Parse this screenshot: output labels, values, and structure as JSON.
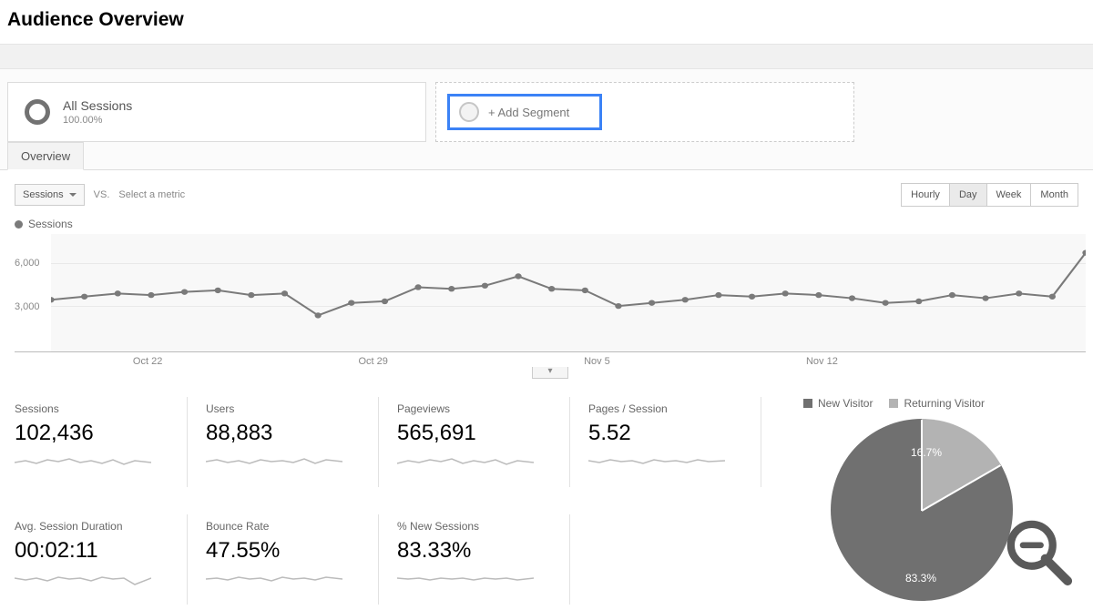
{
  "page": {
    "title": "Audience Overview"
  },
  "segments": {
    "primary": {
      "title": "All Sessions",
      "subtitle": "100.00%"
    },
    "add_label": "+ Add Segment"
  },
  "tabs": {
    "overview": "Overview"
  },
  "controls": {
    "metric": "Sessions",
    "vs": "VS.",
    "select_metric": "Select a metric",
    "periods": {
      "hourly": "Hourly",
      "day": "Day",
      "week": "Week",
      "month": "Month"
    }
  },
  "chart_legend": {
    "series": "Sessions"
  },
  "chart_data": {
    "type": "line",
    "title": "Sessions",
    "xlabel": "",
    "ylabel": "",
    "ylim": [
      0,
      7500
    ],
    "y_ticks": [
      "6,000",
      "3,000"
    ],
    "x_ticks": [
      "Oct 22",
      "Oct 29",
      "Nov 5",
      "Nov 12"
    ],
    "x_dates": [
      "Oct 18",
      "Oct 19",
      "Oct 20",
      "Oct 21",
      "Oct 22",
      "Oct 23",
      "Oct 24",
      "Oct 25",
      "Oct 26",
      "Oct 27",
      "Oct 28",
      "Oct 29",
      "Oct 30",
      "Oct 31",
      "Nov 1",
      "Nov 2",
      "Nov 3",
      "Nov 4",
      "Nov 5",
      "Nov 6",
      "Nov 7",
      "Nov 8",
      "Nov 9",
      "Nov 10",
      "Nov 11",
      "Nov 12",
      "Nov 13",
      "Nov 14",
      "Nov 15",
      "Nov 16",
      "Nov 17"
    ],
    "series": [
      {
        "name": "Sessions",
        "values": [
          3300,
          3500,
          3700,
          3600,
          3800,
          3900,
          3600,
          3700,
          2300,
          3100,
          3200,
          4100,
          4000,
          4200,
          4800,
          4000,
          3900,
          2900,
          3100,
          3300,
          3600,
          3500,
          3700,
          3600,
          3400,
          3100,
          3200,
          3600,
          3400,
          3700,
          3500
        ]
      }
    ],
    "extra_tail_point": 6300
  },
  "metrics": [
    {
      "label": "Sessions",
      "value": "102,436"
    },
    {
      "label": "Users",
      "value": "88,883"
    },
    {
      "label": "Pageviews",
      "value": "565,691"
    },
    {
      "label": "Pages / Session",
      "value": "5.52"
    },
    {
      "label": "Avg. Session Duration",
      "value": "00:02:11"
    },
    {
      "label": "Bounce Rate",
      "value": "47.55%"
    },
    {
      "label": "% New Sessions",
      "value": "83.33%"
    }
  ],
  "pie": {
    "legend": {
      "new": "New Visitor",
      "returning": "Returning Visitor"
    },
    "data": {
      "type": "pie",
      "slices": [
        {
          "name": "New Visitor",
          "value": 83.3,
          "label": "83.3%"
        },
        {
          "name": "Returning Visitor",
          "value": 16.7,
          "label": "16.7%"
        }
      ]
    }
  }
}
